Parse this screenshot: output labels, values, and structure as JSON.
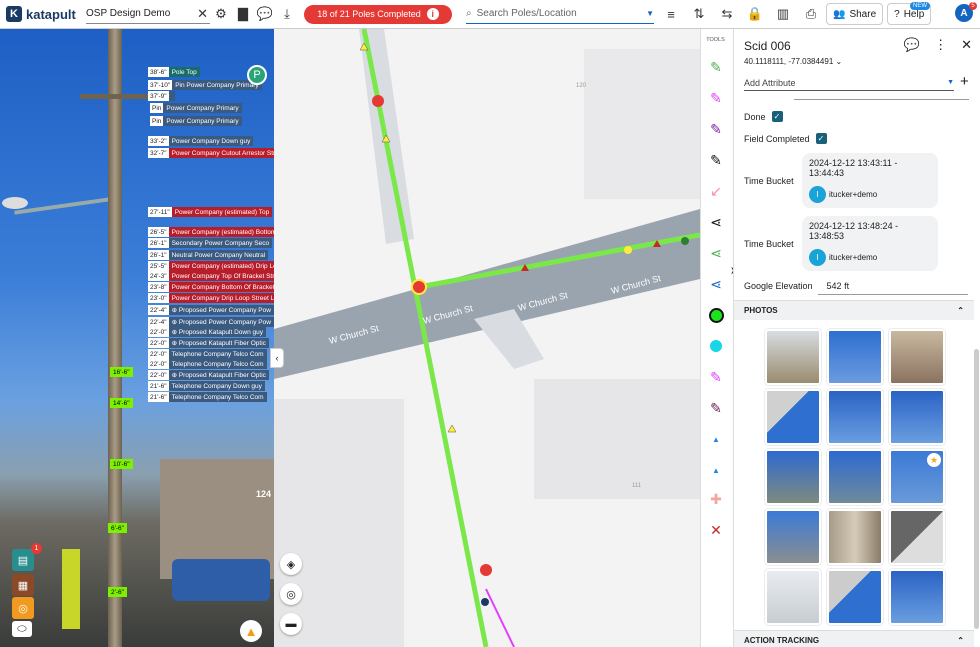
{
  "topbar": {
    "logo": "katapult",
    "project_name": "OSP Design Demo",
    "progress_label": "18 of 21 Poles Completed",
    "search_placeholder": "Search Poles/Location",
    "share_label": "Share",
    "help_label": "Help",
    "new_badge": "NEW",
    "avatar_letter": "A",
    "avatar_badge": "5"
  },
  "photo_view": {
    "top_circle": "P",
    "notification_count": "1",
    "building_number": "124",
    "labels": [
      {
        "height": "38'-6\"",
        "text": "Pole Top",
        "color": "#1a6b6b"
      },
      {
        "height": "37'-10\"",
        "text": "Pin    Power Company Primary",
        "color": "#3a5a80"
      },
      {
        "height": "37'-9\"",
        "text": "",
        "color": "#3a5a80"
      },
      {
        "height": "Pin",
        "text": "Power Company Primary",
        "color": "#3a5a80"
      },
      {
        "height": "Pin",
        "text": "Power Company Primary",
        "color": "#3a5a80"
      },
      {
        "height": "33'-2\"",
        "text": "Power Company Down guy",
        "color": "#3a5a80"
      },
      {
        "height": "32'-7\"",
        "text": "Power Company Cutout Arrestor Str",
        "color": "#b81d2a"
      },
      {
        "height": "27'-11\"",
        "text": "Power Company (estimated) Top",
        "color": "#b81d2a"
      },
      {
        "height": "26'-5\"",
        "text": "Power Company (estimated) Bottom",
        "color": "#b81d2a"
      },
      {
        "height": "26'-1\"",
        "text": "Secondary    Power Company Seco",
        "color": "#3a5a80"
      },
      {
        "height": "26'-1\"",
        "text": "Neutral    Power Company Neutral",
        "color": "#3a5a80"
      },
      {
        "height": "25'-5\"",
        "text": "Power Company (estimated) Drip Lo",
        "color": "#b81d2a"
      },
      {
        "height": "24'-3\"",
        "text": "Power Company Top Of Bracket Str",
        "color": "#b81d2a"
      },
      {
        "height": "23'-8\"",
        "text": "Power Company Bottom Of Bracket",
        "color": "#b81d2a"
      },
      {
        "height": "23'-0\"",
        "text": "Power Company Drip Loop Street Li",
        "color": "#b81d2a"
      },
      {
        "height": "22'-4\"",
        "text": "⊕ Proposed Power Company Pow",
        "color": "#3a5a80"
      },
      {
        "height": "22'-4\"",
        "text": "⊕ Proposed Power Company Pow",
        "color": "#3a5a80"
      },
      {
        "height": "22'-0\"",
        "text": "⊕ Proposed Katapult Down guy",
        "color": "#3a5a80"
      },
      {
        "height": "22'-0\"",
        "text": "⊕ Proposed Katapult Fiber Optic",
        "color": "#3a5a80"
      },
      {
        "height": "22'-0\"",
        "text": "Telephone Company Telco Com",
        "color": "#3a5a80"
      },
      {
        "height": "22'-0\"",
        "text": "Telephone Company Telco Com",
        "color": "#3a5a80"
      },
      {
        "height": "22'-0\"",
        "text": "⊕ Proposed Katapult Fiber Optic",
        "color": "#3a5a80"
      },
      {
        "height": "21'-6\"",
        "text": "Telephone Company Down guy",
        "color": "#3a5a80"
      },
      {
        "height": "21'-6\"",
        "text": "Telephone Company Telco Com",
        "color": "#3a5a80"
      }
    ],
    "markers": [
      "16'-6\"",
      "14'-6\"",
      "10'-6\"",
      "6'-6\"",
      "2'-6\""
    ]
  },
  "map": {
    "street_labels": [
      "W Church St",
      "W Church St",
      "W Church St",
      "W Church St"
    ],
    "lot_numbers": [
      "120",
      "111"
    ]
  },
  "tools": {
    "header": "TOOLS"
  },
  "panel": {
    "title": "Scid 006",
    "coords": "40.1118111, -77.0384491",
    "add_attribute": "Add Attribute",
    "done_label": "Done",
    "field_completed_label": "Field Completed",
    "time_buckets": [
      {
        "label": "Time Bucket",
        "range": "2024-12-12 13:43:11 - 13:44:43",
        "user": "itucker+demo",
        "initial": "I"
      },
      {
        "label": "Time Bucket",
        "range": "2024-12-12 13:48:24 - 13:48:53",
        "user": "itucker+demo",
        "initial": "I"
      }
    ],
    "google_elevation_label": "Google Elevation",
    "google_elevation_value": "542 ft",
    "photos_header": "PHOTOS",
    "action_header": "ACTION TRACKING"
  }
}
